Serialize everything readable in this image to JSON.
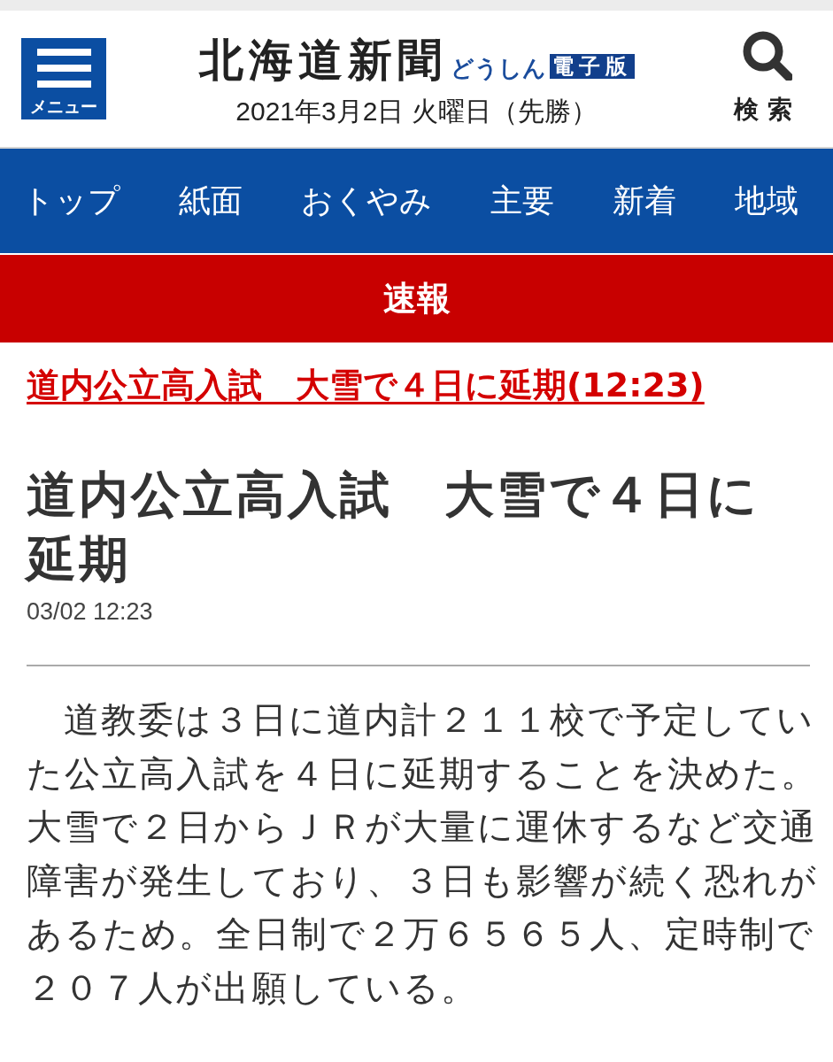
{
  "header": {
    "menu_button": {
      "label": "メニュー"
    },
    "logo": {
      "title": "北海道新聞",
      "subtitle": "どうしん",
      "badge": "電子版"
    },
    "date": "2021年3月2日 火曜日（先勝）",
    "search_button": {
      "label": "検索"
    }
  },
  "nav_tabs": [
    {
      "label": "トップ"
    },
    {
      "label": "紙面"
    },
    {
      "label": "おくやみ"
    },
    {
      "label": "主要"
    },
    {
      "label": "新着"
    },
    {
      "label": "地域"
    }
  ],
  "breaking_banner": {
    "label": "速報"
  },
  "breaking_link": "道内公立高入試　大雪で４日に延期(12:23)",
  "article": {
    "headline": "道内公立高入試　大雪で４日に延期",
    "timestamp": "03/02 12:23",
    "body": "　道教委は３日に道内計２１１校で予定していた公立高入試を４日に延期することを決めた。大雪で２日からＪＲが大量に運休するなど交通障害が発生しており、３日も影響が続く恐れがあるため。全日制で２万６５６５人、定時制で２０７人が出願している。"
  }
}
